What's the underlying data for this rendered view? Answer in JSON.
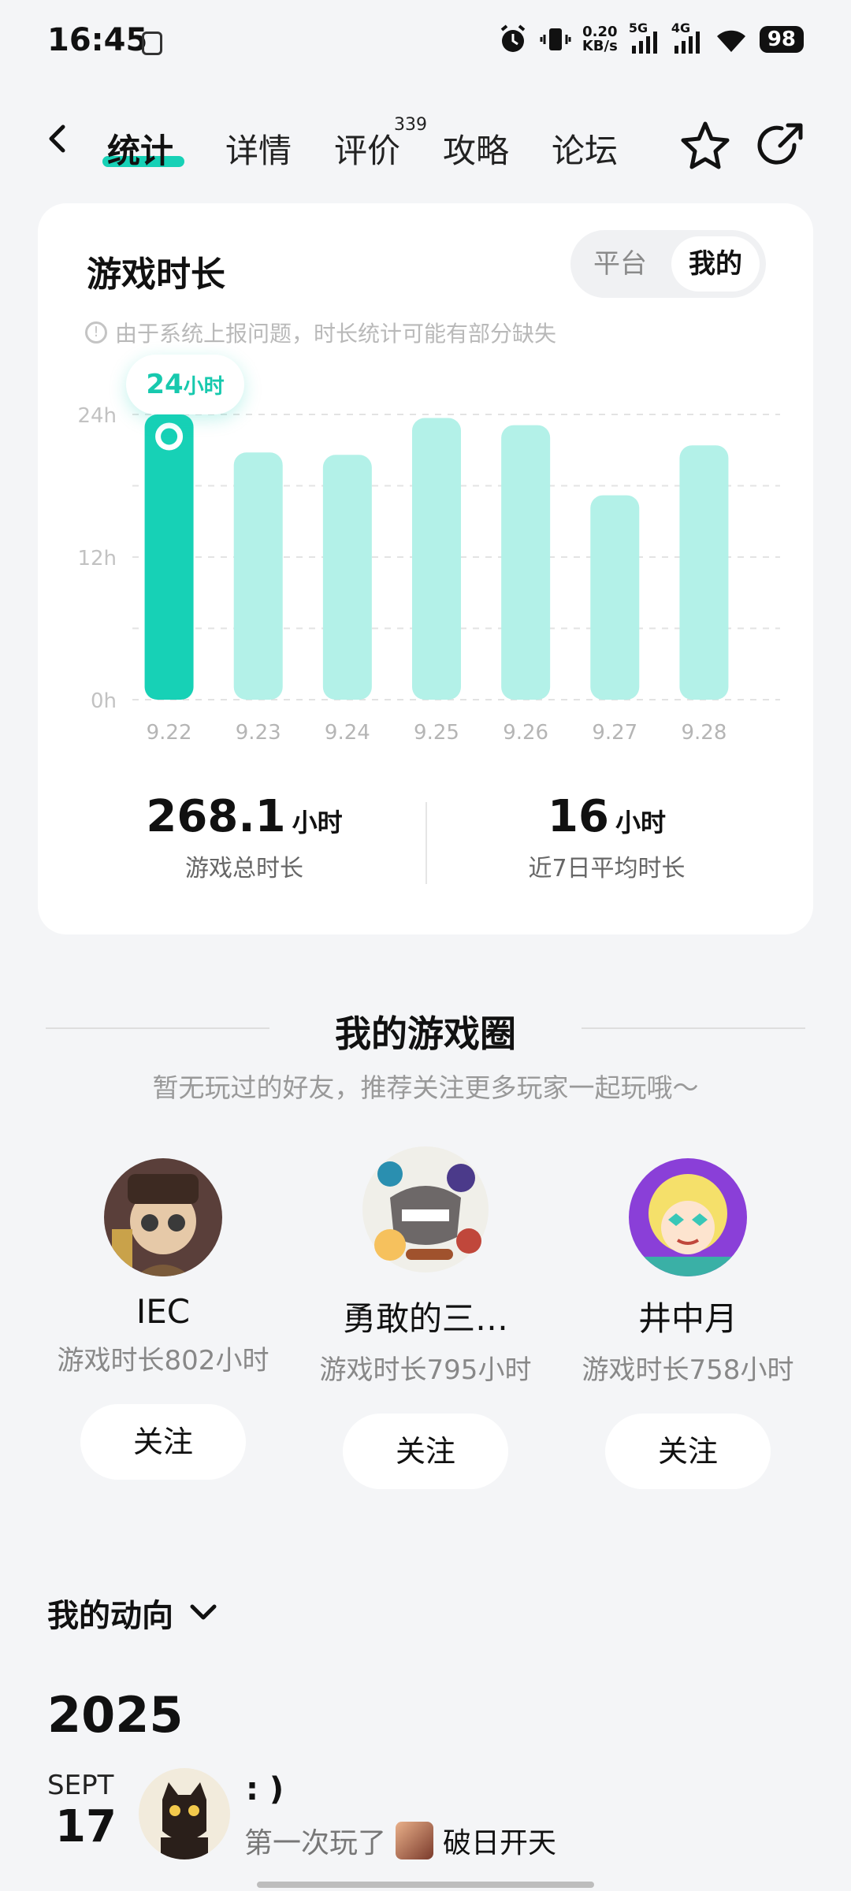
{
  "status_bar": {
    "time": "16:45",
    "net_speed_value": "0.20",
    "net_speed_unit": "KB/s",
    "signal_1": "5G",
    "signal_2": "4G",
    "battery": "98",
    "icons": [
      "alarm-icon",
      "vibrate-icon",
      "signal-icon",
      "wifi-icon",
      "battery-icon"
    ]
  },
  "nav": {
    "tabs": [
      "统计",
      "详情",
      "评价",
      "攻略",
      "论坛"
    ],
    "active_tab": "统计",
    "review_count": "339",
    "icons": [
      "back-icon",
      "star-icon",
      "share-icon"
    ]
  },
  "stats_card": {
    "title": "游戏时长",
    "segment": {
      "options": [
        "平台",
        "我的"
      ],
      "selected": "我的"
    },
    "notice": "由于系统上报问题，时长统计可能有部分缺失",
    "tooltip_value": "24",
    "tooltip_unit": "小时",
    "total_value": "268.1",
    "total_unit": "小时",
    "total_label": "游戏总时长",
    "avg_value": "16",
    "avg_unit": "小时",
    "avg_label": "近7日平均时长"
  },
  "chart_data": {
    "type": "bar",
    "categories": [
      "9.22",
      "9.23",
      "9.24",
      "9.25",
      "9.26",
      "9.27",
      "9.28"
    ],
    "values": [
      24,
      20.8,
      20.6,
      23.7,
      23.1,
      17.2,
      21.4
    ],
    "y_ticks": [
      "0h",
      "12h",
      "24h"
    ],
    "ylim": [
      0,
      24
    ],
    "highlighted_index": 0,
    "grid": true,
    "colors": {
      "highlight": "#17d1b6",
      "normal": "#b3f1e8",
      "grid": "#e3e3e3"
    }
  },
  "circle": {
    "title": "我的游戏圈",
    "subtitle": "暂无玩过的好友，推荐关注更多玩家一起玩哦～",
    "friends": [
      {
        "name": "IEC",
        "hours": "游戏时长802小时",
        "follow": "关注"
      },
      {
        "name": "勇敢的三…",
        "hours": "游戏时长795小时",
        "follow": "关注"
      },
      {
        "name": "井中月",
        "hours": "游戏时长758小时",
        "follow": "关注"
      }
    ]
  },
  "activity": {
    "header": "我的动向",
    "year": "2025",
    "month": "SEPT",
    "day": "17",
    "user_name": ": )",
    "action": "第一次玩了",
    "game": "破日开天"
  },
  "colors": {
    "accent": "#17d1b6",
    "background": "#f4f5f7"
  }
}
